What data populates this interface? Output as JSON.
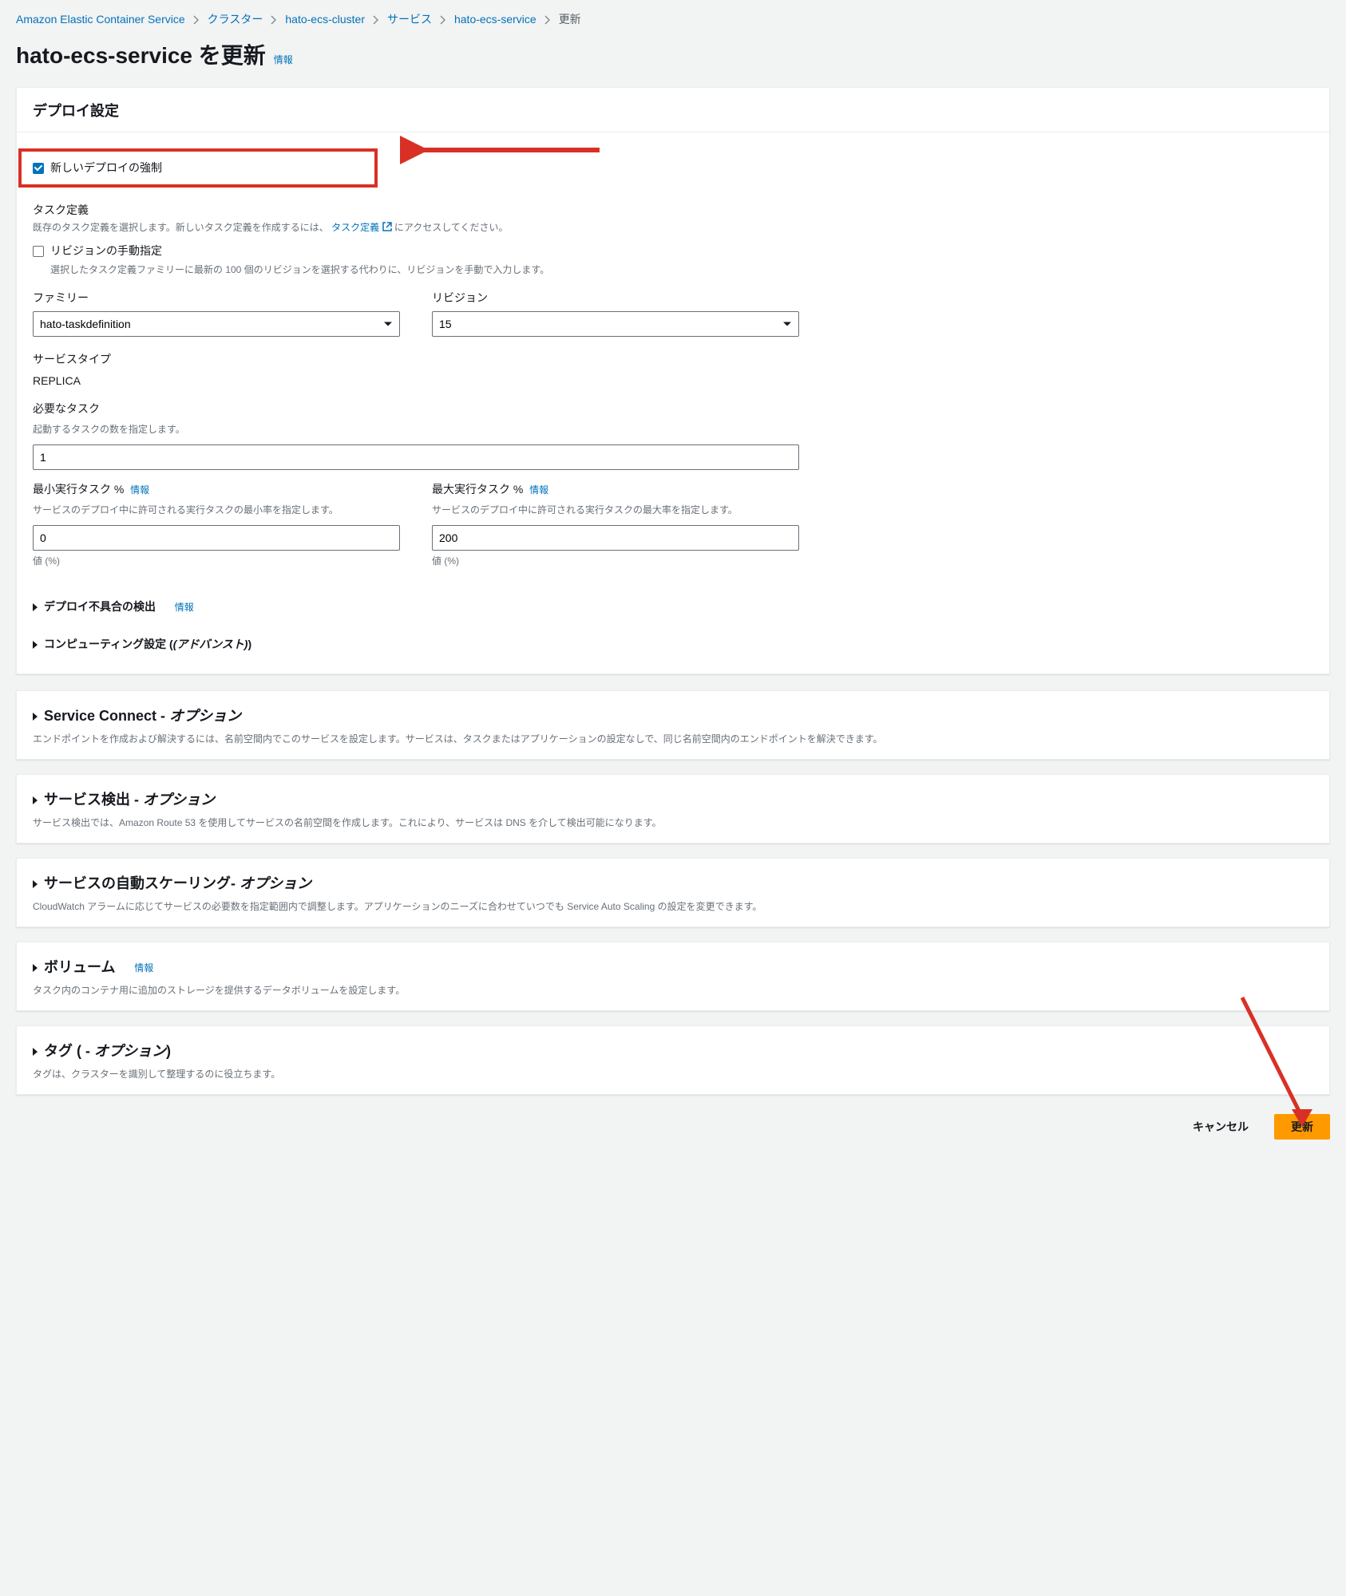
{
  "breadcrumb": {
    "items": [
      {
        "label": "Amazon Elastic Container Service",
        "link": true
      },
      {
        "label": "クラスター",
        "link": true
      },
      {
        "label": "hato-ecs-cluster",
        "link": true
      },
      {
        "label": "サービス",
        "link": true
      },
      {
        "label": "hato-ecs-service",
        "link": true
      },
      {
        "label": "更新",
        "link": false
      }
    ]
  },
  "page": {
    "title": "hato-ecs-service を更新",
    "info": "情報"
  },
  "deploy": {
    "title": "デプロイ設定",
    "force_new_deployment": "新しいデプロイの強制",
    "task_def": {
      "label": "タスク定義",
      "desc_before": "既存のタスク定義を選択します。新しいタスク定義を作成するには、",
      "desc_link": "タスク定義",
      "desc_after": " にアクセスしてください。",
      "manual_checkbox": "リビジョンの手動指定",
      "manual_desc": "選択したタスク定義ファミリーに最新の 100 個のリビジョンを選択する代わりに、リビジョンを手動で入力します。"
    },
    "family": {
      "label": "ファミリー",
      "value": "hato-taskdefinition"
    },
    "revision": {
      "label": "リビジョン",
      "value": "15"
    },
    "service_type": {
      "label": "サービスタイプ",
      "value": "REPLICA"
    },
    "desired_tasks": {
      "label": "必要なタスク",
      "desc": "起動するタスクの数を指定します。",
      "value": "1"
    },
    "min_tasks": {
      "label": "最小実行タスク %",
      "info": "情報",
      "desc": "サービスのデプロイ中に許可される実行タスクの最小率を指定します。",
      "value": "0",
      "hint": "値 (%)"
    },
    "max_tasks": {
      "label": "最大実行タスク %",
      "info": "情報",
      "desc": "サービスのデプロイ中に許可される実行タスクの最大率を指定します。",
      "value": "200",
      "hint": "値 (%)"
    },
    "detect_failures": {
      "label": "デプロイ不具合の検出",
      "info": "情報"
    },
    "compute_config": {
      "label_prefix": "コンピューティング設定 (",
      "label_italic": "(アドバンスト)",
      "label_suffix": ")"
    }
  },
  "sections": {
    "service_connect": {
      "title_plain": "Service Connect - ",
      "title_italic": "オプション",
      "desc": "エンドポイントを作成および解決するには、名前空間内でこのサービスを設定します。サービスは、タスクまたはアプリケーションの設定なしで、同じ名前空間内のエンドポイントを解決できます。"
    },
    "service_discovery": {
      "title_plain": "サービス検出 - ",
      "title_italic": "オプション",
      "desc": "サービス検出では、Amazon Route 53 を使用してサービスの名前空間を作成します。これにより、サービスは DNS を介して検出可能になります。"
    },
    "autoscaling": {
      "title_plain": "サービスの自動スケーリング- ",
      "title_italic": "オプション",
      "desc": "CloudWatch アラームに応じてサービスの必要数を指定範囲内で調整します。アプリケーションのニーズに合わせていつでも Service Auto Scaling の設定を変更できます。"
    },
    "volume": {
      "title_plain": "ボリューム",
      "info": "情報",
      "desc": "タスク内のコンテナ用に追加のストレージを提供するデータボリュームを設定します。"
    },
    "tags": {
      "title_plain": "タグ ( - ",
      "title_italic": "オプション",
      "title_suffix": ")",
      "desc": "タグは、クラスターを識別して整理するのに役立ちます。"
    }
  },
  "footer": {
    "cancel": "キャンセル",
    "submit": "更新"
  }
}
